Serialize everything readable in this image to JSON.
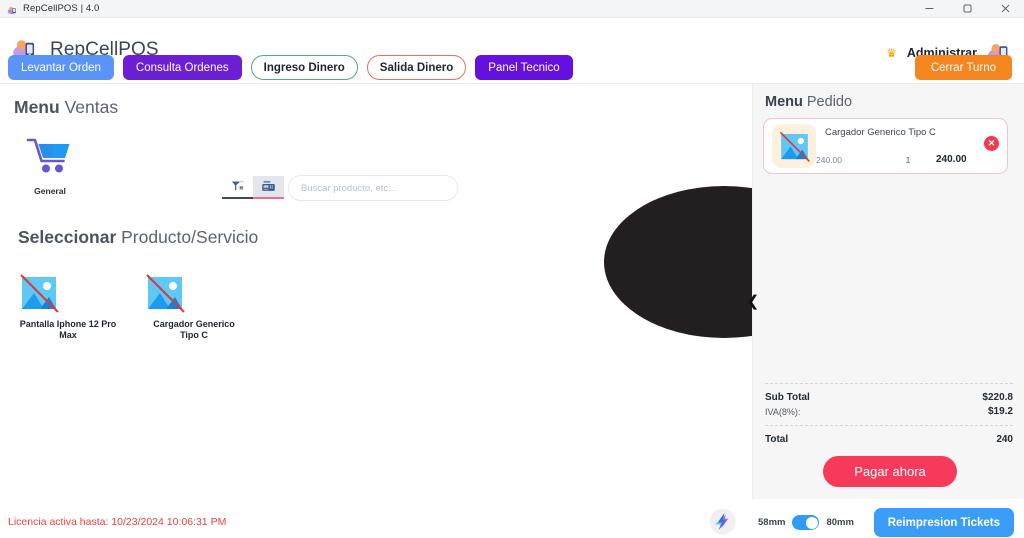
{
  "window": {
    "title": "RepCellPOS  | 4.0",
    "app_icon": "app-logo-icon",
    "controls": {
      "minimize": "minimize-icon",
      "maximize": "maximize-icon",
      "close": "close-icon"
    }
  },
  "header": {
    "brand": "RepCellPOS",
    "brand_logo": "repcellpos-logo-icon",
    "crown": "crown-icon",
    "admin_label": "Administrar",
    "avatar": "user-avatar-icon",
    "cerrar_turno": "Cerrar Turno",
    "nav": [
      {
        "label": "Levantar Orden",
        "style": "blue"
      },
      {
        "label": "Consulta Ordenes",
        "style": "purple"
      },
      {
        "label": "Ingreso Dinero",
        "style": "outline-green"
      },
      {
        "label": "Salida Dinero",
        "style": "outline-red"
      },
      {
        "label": "Panel Tecnico",
        "style": "purple2"
      }
    ]
  },
  "main": {
    "menu_title_strong": "Menu",
    "menu_title_rest": " Ventas",
    "scan_tabs": [
      {
        "icon": "barcode-scanner-icon",
        "active": false
      },
      {
        "icon": "cash-register-icon",
        "active": true
      }
    ],
    "search": {
      "placeholder": "Buscar producto, etc...",
      "value": ""
    },
    "categories": [
      {
        "label": "General",
        "icon": "shopping-cart-icon"
      }
    ],
    "select_title_strong": "Seleccionar",
    "select_title_rest": " Producto/Servicio",
    "products": [
      {
        "name": "Pantalla Iphone 12 Pro Max",
        "icon": "broken-image-icon"
      },
      {
        "name": "Cargador Generico Tipo C",
        "icon": "broken-image-icon"
      }
    ]
  },
  "order_panel": {
    "title_strong": "Menu",
    "title_rest": " Pedido",
    "collapse_icon": "chevron-left-icon",
    "items": [
      {
        "name": "Cargador Generico Tipo C",
        "unit_price": "240.00",
        "qty": "1",
        "line_total": "240.00",
        "thumb": "broken-image-icon",
        "remove_icon": "remove-item-icon"
      }
    ],
    "totals": [
      {
        "label": "Sub Total",
        "value": "$220.8",
        "bold": true
      },
      {
        "label": "IVA(8%):",
        "value": "$19.2",
        "bold": false
      },
      {
        "label": "Total",
        "value": "240",
        "bold": true
      }
    ],
    "pay_button": "Pagar ahora"
  },
  "footer": {
    "license": "Licencia activa hasta: 10/23/2024 10:06:31 PM",
    "logo": "company-logo-icon",
    "paper_small": "58mm",
    "paper_large": "80mm",
    "toggle_state": "80mm",
    "reprint_button": "Reimpresion Tickets"
  },
  "colors": {
    "accent_blue": "#5b94f7",
    "purple": "#6c1fd4",
    "green_outline": "#4caf7d",
    "red_outline": "#e8705f",
    "orange": "#f5851f",
    "pink": "#f73a5c",
    "license_red": "#f04040",
    "panel_bg": "#f6f6f6",
    "toggle_blue": "#2f9bf5"
  }
}
